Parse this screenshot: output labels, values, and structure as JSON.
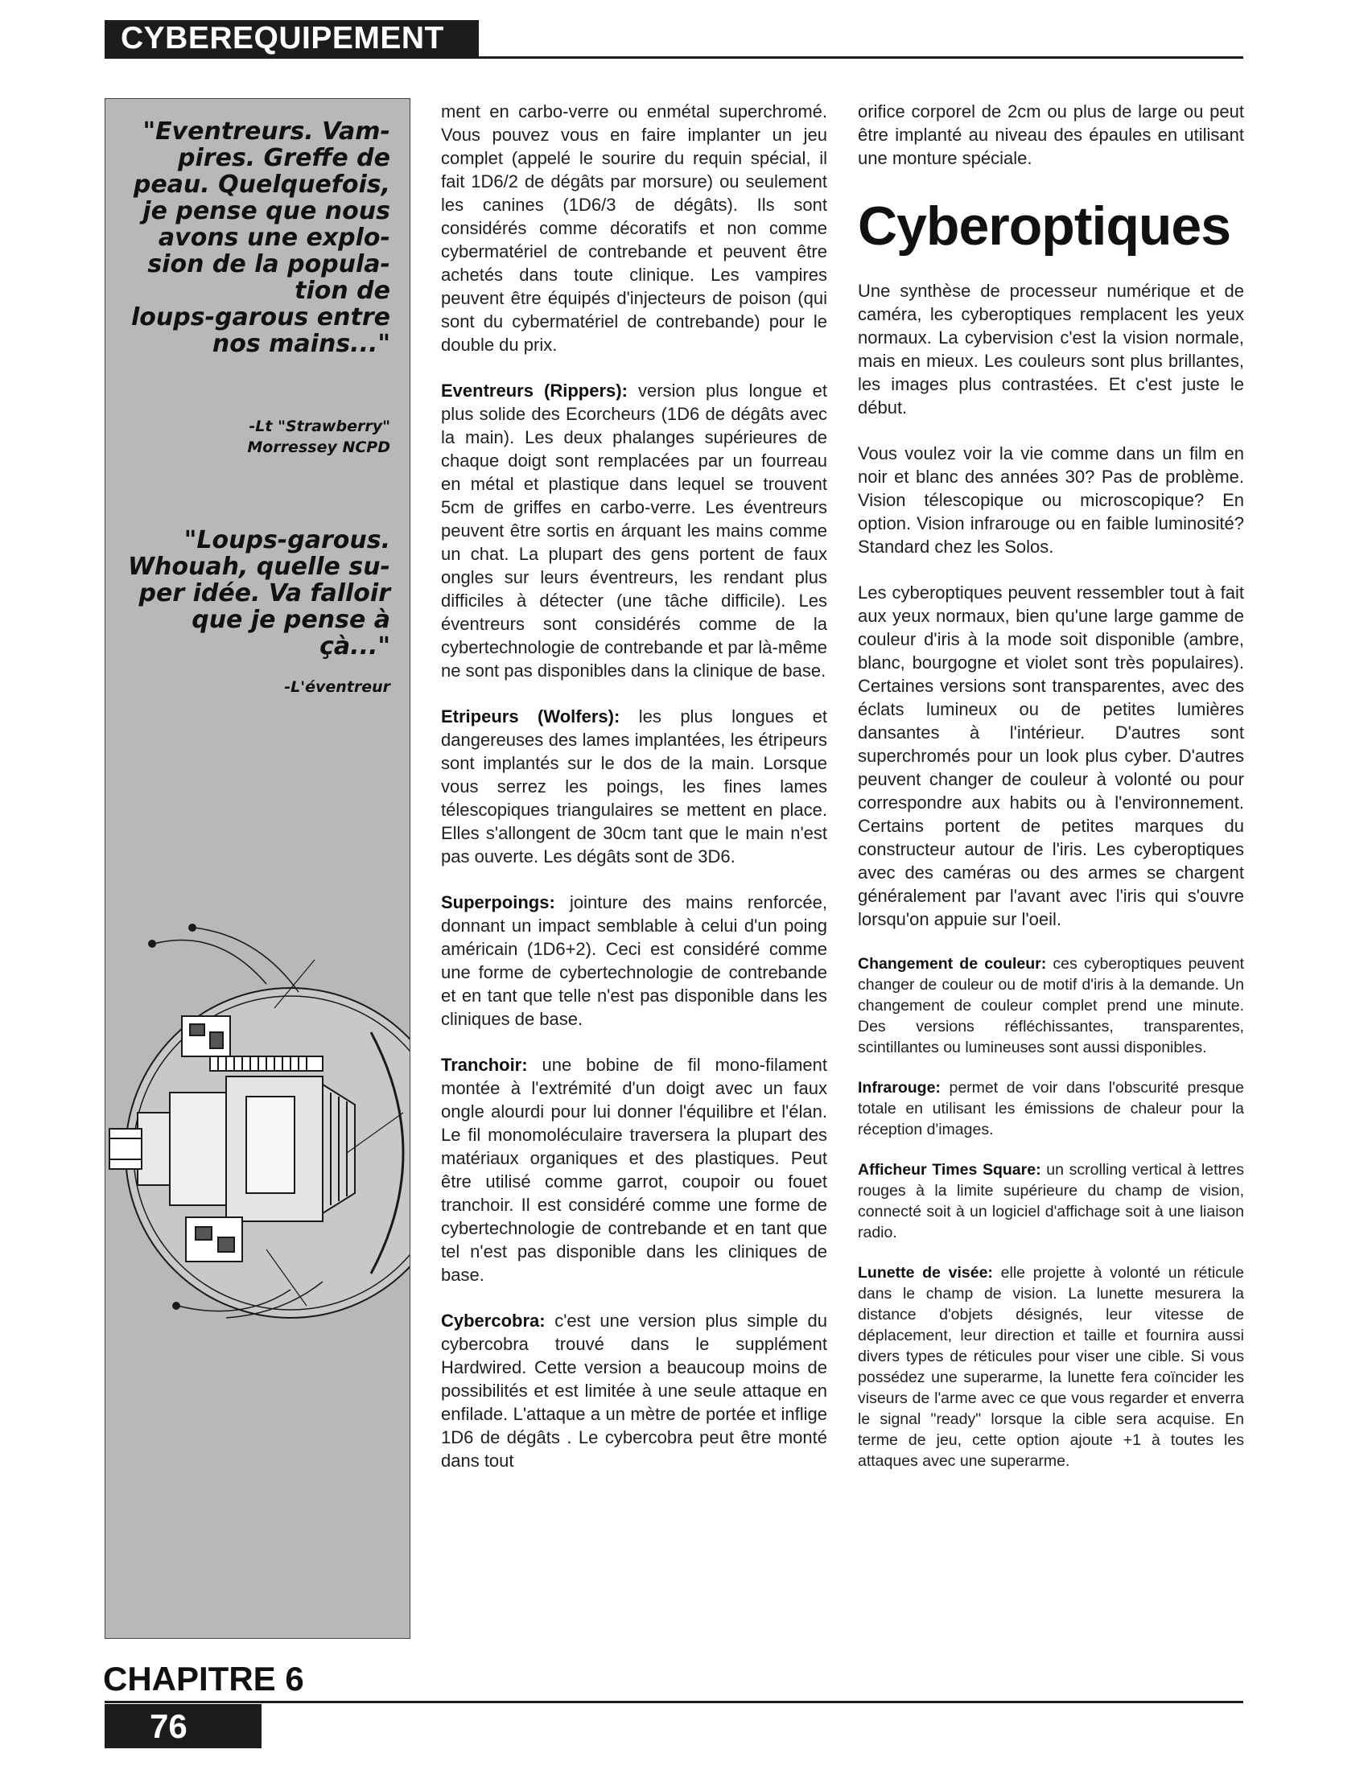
{
  "header": {
    "title": "CYBEREQUIPEMENT"
  },
  "sidebar": {
    "quote1": [
      "\"Eventreurs. Vam-",
      "pires. Greffe de",
      "peau. Quelquefois,",
      "je pense que nous",
      "avons une explo-",
      "sion de la popula-",
      "tion de",
      "loups-garous entre",
      "nos mains...\""
    ],
    "attribution1": [
      "-Lt \"Strawberry\"",
      "Morressey NCPD"
    ],
    "quote2": [
      "\"Loups-garous.",
      "Whouah, quelle su-",
      "per idée. Va falloir",
      "que je pense à",
      "çà...\""
    ],
    "attribution2": [
      "-L'éventreur"
    ]
  },
  "column1": {
    "intro": "ment en carbo-verre ou enmétal superchromé. Vous pouvez vous en faire implanter un jeu complet (appelé le sourire du requin spécial, il fait 1D6/2 de dégâts par morsure) ou seulement les canines (1D6/3 de dégâts). Ils sont considérés comme décoratifs et non comme cybermatériel de contrebande et peuvent être achetés dans toute clinique. Les vampires peuvent être équipés d'injecteurs de poison (qui sont du cybermatériel de contrebande) pour le double du prix.",
    "entries": [
      {
        "term": "Eventreurs (Rippers):",
        "text": " version plus longue et plus solide des Ecorcheurs (1D6 de dégâts avec la main). Les deux phalanges supérieures de chaque doigt sont remplacées par un fourreau en métal et plastique dans lequel se trouvent 5cm de griffes en carbo-verre. Les éventreurs peuvent être sortis en árquant les mains comme un chat. La plupart des gens portent de faux ongles sur leurs éventreurs, les rendant plus difficiles à détecter (une tâche difficile). Les éventreurs sont considérés comme de la cybertechnologie de contrebande et par là-même ne sont pas disponibles dans la clinique de base."
      },
      {
        "term": "Etripeurs (Wolfers):",
        "text": " les plus longues et dangereuses des lames implantées, les étripeurs sont implantés sur le dos de la main. Lorsque vous serrez les poings, les fines lames télescopiques triangulaires se mettent en place. Elles s'allongent de 30cm tant que le main n'est pas ouverte. Les dégâts sont de 3D6."
      },
      {
        "term": "Superpoings:",
        "text": " jointure des mains renforcée, donnant un impact semblable à celui d'un poing américain (1D6+2). Ceci est considéré comme une forme de cybertechnologie de contrebande et en tant que telle n'est pas disponible dans les cliniques de base."
      },
      {
        "term": "Tranchoir:",
        "text": " une bobine de fil mono-filament montée à l'extrémité d'un doigt avec un faux ongle alourdi pour lui donner l'équilibre et l'élan. Le fil monomoléculaire traversera la plupart des matériaux organiques et des plastiques. Peut être utilisé comme garrot, coupoir ou fouet tranchoir. Il est considéré comme une forme de cybertechnologie de contrebande et en tant que tel n'est pas disponible dans les cliniques de base."
      },
      {
        "term": "Cybercobra:",
        "text": " c'est une version plus simple du cybercobra trouvé dans le supplément Hardwired. Cette version a beaucoup moins de possibilités et est limitée à une seule attaque en enfilade. L'attaque a un mètre de portée et inflige 1D6 de dégâts . Le cybercobra peut être monté dans tout"
      }
    ]
  },
  "column2": {
    "continuation": "orifice corporel de 2cm ou plus de large ou peut être implanté au niveau des épaules en utilisant une monture spéciale.",
    "heading": "Cyberoptiques",
    "paragraphs": [
      "Une synthèse de processeur numérique et de caméra, les cyberoptiques remplacent les yeux normaux. La cybervision c'est la vision normale, mais en mieux. Les couleurs sont plus brillantes, les images plus contrastées. Et c'est juste le début.",
      "Vous voulez voir la vie comme dans un film en noir et blanc des années 30? Pas de problème. Vision télescopique ou microscopique? En option. Vision infrarouge ou en faible luminosité? Standard chez les Solos.",
      "Les cyberoptiques peuvent ressembler tout à fait aux yeux normaux, bien qu'une large gamme de couleur d'iris à la mode soit disponible (ambre, blanc, bourgogne et violet sont très populaires). Certaines versions sont transparentes, avec des éclats lumineux ou de petites lumières dansantes à l'intérieur. D'autres sont superchromés pour un look plus cyber. D'autres peuvent changer de couleur à volonté ou pour correspondre aux habits ou à l'environnement. Certains portent de petites marques du constructeur autour de l'iris. Les cyberoptiques avec des caméras ou des armes se chargent généralement par l'avant avec l'iris qui s'ouvre lorsqu'on appuie sur l'oeil."
    ],
    "entries": [
      {
        "term": "Changement de couleur:",
        "text": " ces cyberoptiques peuvent changer de couleur ou de motif d'iris à la demande. Un changement de couleur complet prend une minute. Des versions réfléchissantes, transparentes, scintillantes ou lumineuses sont aussi disponibles."
      },
      {
        "term": "Infrarouge:",
        "text": " permet de voir dans l'obscurité presque totale en utilisant les émissions de chaleur pour la réception d'images."
      },
      {
        "term": "Afficheur Times Square:",
        "text": " un scrolling vertical à lettres rouges à la limite supérieure du champ de vision, connecté soit à un logiciel d'affichage soit à une liaison radio."
      },
      {
        "term": "Lunette de visée:",
        "text": " elle projette à volonté un réticule dans le champ de vision. La lunette mesurera la distance d'objets désignés, leur vitesse de déplacement, leur direction et taille et fournira aussi divers types de réticules pour viser une cible. Si vous possédez une superarme, la lunette fera coïncider les viseurs de l'arme avec ce que vous regarder et enverra le signal \"ready\" lorsque la cible sera acquise. En terme de jeu, cette option ajoute +1 à toutes les attaques avec une superarme."
      }
    ]
  },
  "footer": {
    "chapter": "CHAPITRE 6",
    "page": "76"
  }
}
